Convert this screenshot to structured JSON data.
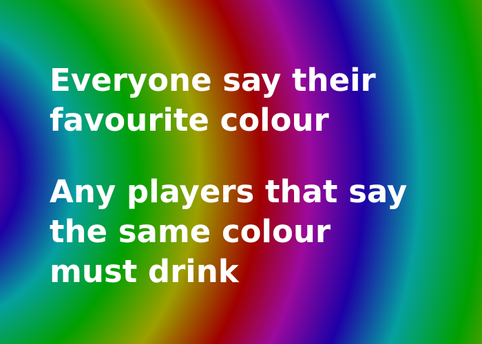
{
  "card": {
    "background_colors": [
      "#a00000",
      "#9c0a9c",
      "#1e00a6",
      "#06a0a0",
      "#00a000",
      "#9ca000"
    ],
    "text_color": "#ffffff",
    "prompt_1": {
      "lines": [
        "Everyone say their",
        "favourite colour"
      ]
    },
    "prompt_2": {
      "lines": [
        "Any players that say",
        "the same colour",
        "must drink"
      ]
    }
  }
}
